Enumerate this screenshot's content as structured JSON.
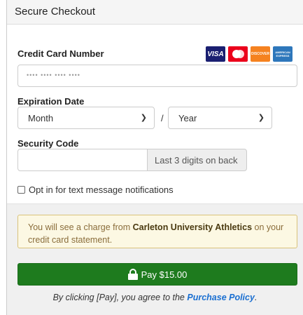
{
  "header": {
    "title": "Secure Checkout"
  },
  "card_number": {
    "label": "Credit Card Number",
    "placeholder": "•••• •••• •••• ••••",
    "brands": {
      "visa": "VISA",
      "mastercard": "mastercard",
      "discover": "DISCOVER",
      "amex": "AMERICAN EXPRESS"
    }
  },
  "expiration": {
    "label": "Expiration Date",
    "month_value": "Month",
    "separator": "/",
    "year_value": "Year"
  },
  "security": {
    "label": "Security Code",
    "addon": "Last 3 digits on back"
  },
  "opt_in": {
    "label": "Opt in for text message notifications",
    "checked": false
  },
  "notice": {
    "prefix": "You will see a charge from ",
    "merchant": "Carleton University Athletics",
    "suffix": " on your credit card statement."
  },
  "pay_button": {
    "label": "Pay $15.00",
    "color": "#1e7b1e"
  },
  "policy": {
    "prefix": "By clicking [Pay], you agree to the ",
    "link": "Purchase Policy",
    "suffix": "."
  }
}
